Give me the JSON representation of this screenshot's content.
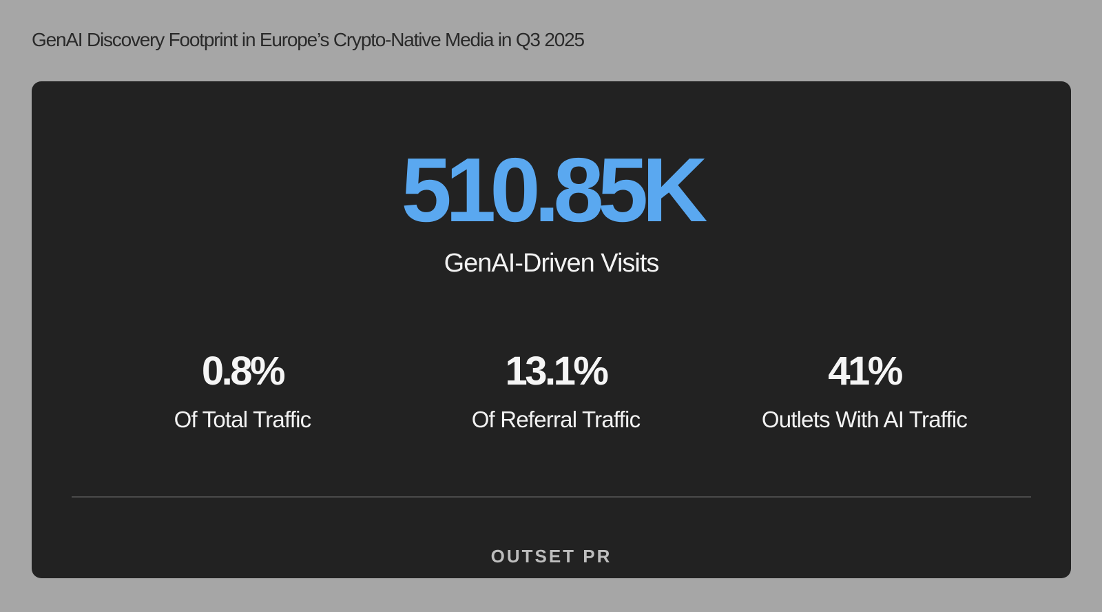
{
  "title": "GenAI Discovery Footprint in Europe’s Crypto-Native Media in Q3 2025",
  "hero": {
    "value": "510.85K",
    "label": "GenAI-Driven Visits",
    "color": "#5aa8f0"
  },
  "stats": [
    {
      "value": "0.8%",
      "label": "Of Total Traffic"
    },
    {
      "value": "13.1%",
      "label": "Of Referral Traffic"
    },
    {
      "value": "41%",
      "label": "Outlets With AI Traffic"
    }
  ],
  "logo": "OUTSET PR"
}
